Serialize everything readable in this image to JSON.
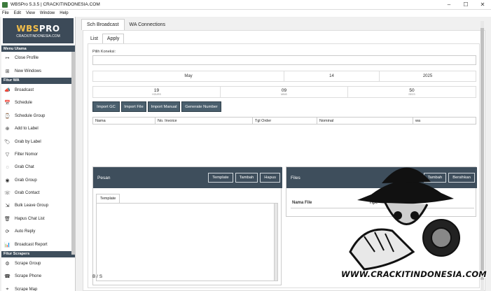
{
  "window": {
    "title": "WBSPro 5.3.5 | CRACKITINDONESIA.COM",
    "minimize": "–",
    "maximize": "☐",
    "close": "✕"
  },
  "menu": [
    "File",
    "Edit",
    "View",
    "Window",
    "Help"
  ],
  "logo": {
    "main_a": "WBS",
    "main_b": "PRO",
    "sub": "CRACKITINDONESIA.COM"
  },
  "sidebar": {
    "sec_menu": "Menu Utama",
    "menu_items": [
      {
        "label": "Close Profile",
        "icon": "↦"
      },
      {
        "label": "New Windows",
        "icon": "⊞"
      }
    ],
    "sec_wa": "Fitur WA",
    "wa_items": [
      {
        "label": "Broadcast",
        "icon": "📣"
      },
      {
        "label": "Schedule",
        "icon": "📅"
      },
      {
        "label": "Schedule Group",
        "icon": "⌚"
      },
      {
        "label": "Add to Label",
        "icon": "⊕"
      },
      {
        "label": "Grab by Label",
        "icon": "🏷"
      },
      {
        "label": "Filter Nomor",
        "icon": "▽"
      },
      {
        "label": "Grab Chat",
        "icon": "◌"
      },
      {
        "label": "Grab Group",
        "icon": "◉"
      },
      {
        "label": "Grab Contact",
        "icon": "☏"
      },
      {
        "label": "Bulk Leave Group",
        "icon": "⇲"
      },
      {
        "label": "Hapus Chat List",
        "icon": "🗑"
      },
      {
        "label": "Auto Reply",
        "icon": "⟳"
      },
      {
        "label": "Broadcast Report",
        "icon": "📊"
      }
    ],
    "sec_scrapers": "Fitur Scrapers",
    "scraper_items": [
      {
        "label": "Scrape Group",
        "icon": "⚙"
      },
      {
        "label": "Scrape Phone",
        "icon": "☎"
      },
      {
        "label": "Scrape Map",
        "icon": "⌖"
      }
    ]
  },
  "main": {
    "tabs": [
      "Sch Broadcast",
      "WA Connections"
    ],
    "subtabs": [
      "List",
      "Apply"
    ],
    "pilih_koneksi": "Pilih Koneksi:",
    "date": {
      "month": "May",
      "day": "14",
      "year": "2025"
    },
    "time": {
      "hours": "19",
      "hours_label": "HOURS",
      "mins": "09",
      "mins_label": "MINS",
      "secs": "50",
      "secs_label": "SECS"
    },
    "buttons": [
      "Import GC",
      "Import File",
      "Import Manual",
      "Generate Number"
    ],
    "grid_columns": [
      "Nama",
      "No. Invoice",
      "Tgl Order",
      "Nominal",
      "wa"
    ],
    "pesan": {
      "title": "Pesan",
      "buttons": [
        "Template",
        "Tambah",
        "Hapus"
      ],
      "tab": "Template"
    },
    "files": {
      "title": "Files",
      "buttons": [
        "Tambah",
        "Bersihkan"
      ],
      "col_nama": "Nama File",
      "col_tipe": "Tipe"
    },
    "bottom": "B / S"
  },
  "watermark": "WWW.CRACKITINDONESIA.COM",
  "colors": {
    "header_dark": "#3e4e5c",
    "button": "#4a5f6d",
    "logo_gold": "#f6c04a"
  }
}
